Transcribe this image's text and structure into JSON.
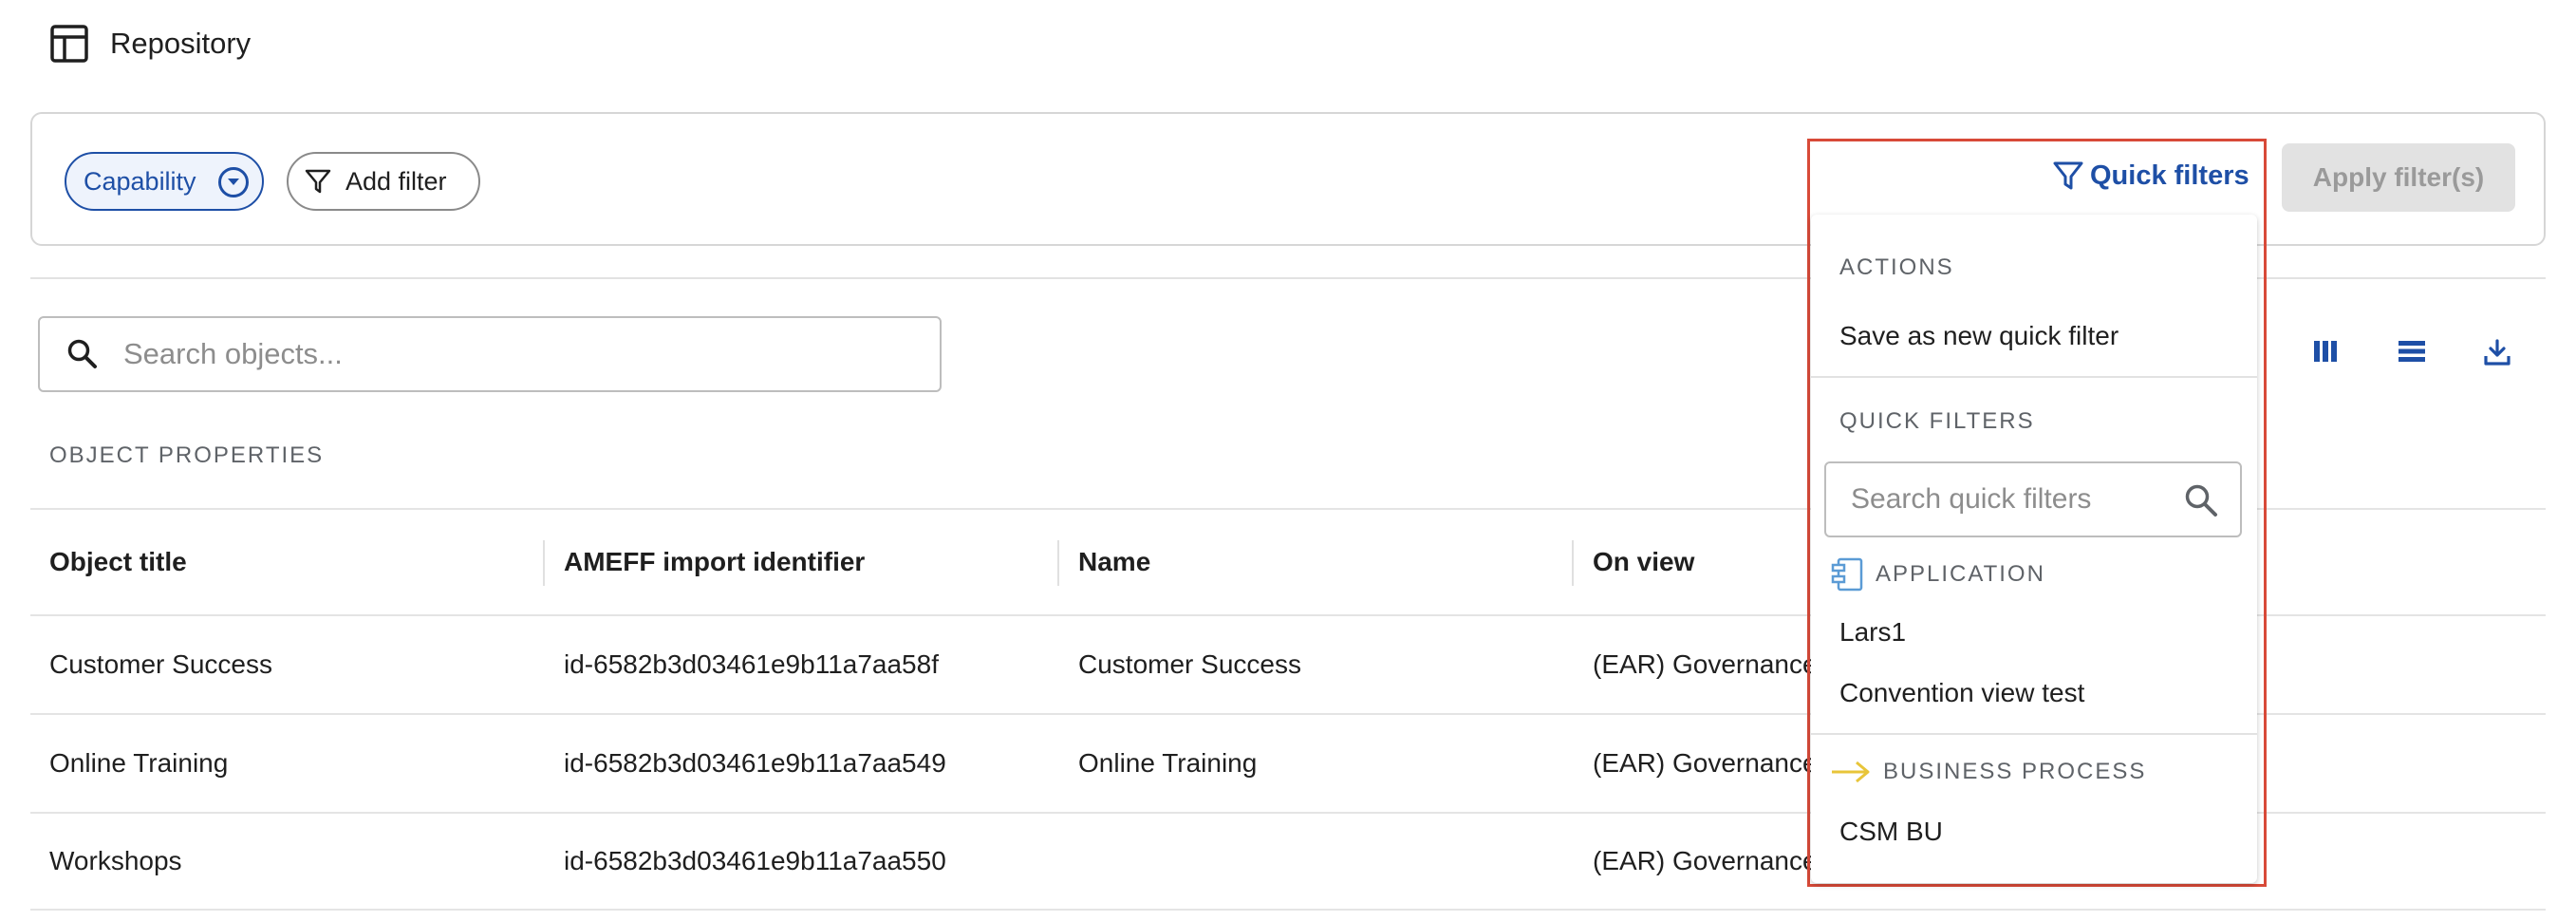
{
  "header": {
    "title": "Repository",
    "icon": "table-icon"
  },
  "filters": {
    "chips": [
      {
        "label": "Capability",
        "icon": "chevron-down-circle-icon"
      },
      {
        "label": "Add filter",
        "icon": "filter-icon"
      }
    ],
    "quick_filters_label": "Quick filters",
    "apply_label": "Apply filter(s)"
  },
  "search": {
    "placeholder": "Search objects..."
  },
  "section_label": "OBJECT PROPERTIES",
  "table": {
    "columns": [
      "Object title",
      "AMEFF import identifier",
      "Name",
      "On view"
    ],
    "rows": [
      [
        "Customer Success",
        "id-6582b3d03461e9b11a7aa58f",
        "Customer Success",
        "(EAR) Governance"
      ],
      [
        "Online Training",
        "id-6582b3d03461e9b11a7aa549",
        "Online Training",
        "(EAR) Governance"
      ],
      [
        "Workshops",
        "id-6582b3d03461e9b11a7aa550",
        "",
        "(EAR) Governance"
      ]
    ]
  },
  "quick_filter_menu": {
    "actions_heading": "ACTIONS",
    "save_action": "Save as new quick filter",
    "quick_filters_heading": "QUICK FILTERS",
    "search_placeholder": "Search quick filters",
    "groups": [
      {
        "name": "APPLICATION",
        "icon": "application-component-icon",
        "items": [
          "Lars1",
          "Convention view test"
        ]
      },
      {
        "name": "BUSINESS PROCESS",
        "icon": "arrow-right-icon",
        "items": [
          "CSM BU"
        ]
      }
    ]
  },
  "colors": {
    "accent": "#1e4fa6",
    "highlight_border": "#d84a38",
    "application_icon": "#5b9bd5",
    "process_icon": "#e8c53a"
  }
}
